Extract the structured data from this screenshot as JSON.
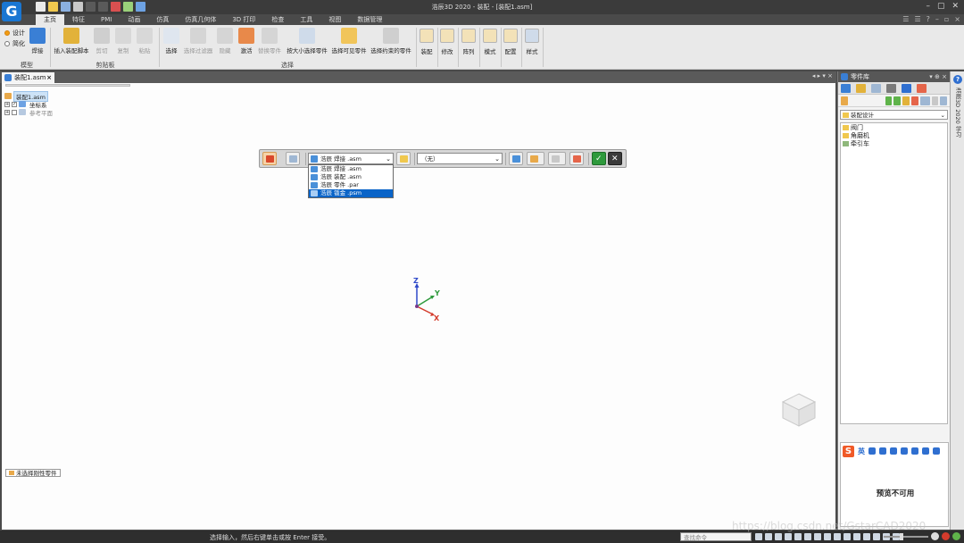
{
  "titlebar": {
    "title": "浩辰3D 2020 - 装配 - [装配1.asm]",
    "logo": "G"
  },
  "tabs": [
    {
      "label": "主页",
      "active": true
    },
    {
      "label": "特征",
      "active": false
    },
    {
      "label": "PMI",
      "active": false
    },
    {
      "label": "动画",
      "active": false
    },
    {
      "label": "仿真",
      "active": false
    },
    {
      "label": "仿真几何体",
      "active": false
    },
    {
      "label": "3D 打印",
      "active": false
    },
    {
      "label": "检查",
      "active": false
    },
    {
      "label": "工具",
      "active": false
    },
    {
      "label": "视图",
      "active": false
    },
    {
      "label": "数据管理",
      "active": false
    }
  ],
  "ribbon": {
    "mode_design": "设计",
    "mode_simplify": "简化",
    "weld": "焊接",
    "group_model": "模型",
    "insert_assembly_script": "插入装配脚本",
    "cut": "剪切",
    "copy": "复制",
    "paste": "粘贴",
    "group_clipboard": "剪贴板",
    "select": "选择",
    "select_filter": "选择过滤器",
    "hide": "隐藏",
    "activate": "激活",
    "replace_part": "替换零件",
    "select_by_size": "按大小选择零件",
    "select_visible": "选择可见零件",
    "select_constrained": "选择约束的零件",
    "group_select": "选择",
    "assemble": "装配",
    "modify": "修改",
    "array": "阵列",
    "pattern": "模式",
    "config": "配置",
    "style": "样式"
  },
  "document": {
    "tab_label": "装配1.asm",
    "tree": [
      {
        "label": "装配1.asm",
        "selected": true,
        "muted": false
      },
      {
        "label": "坐标系",
        "selected": false,
        "muted": false
      },
      {
        "label": "参考平面",
        "selected": false,
        "muted": true
      }
    ]
  },
  "command_bar": {
    "template_value": "浩辰 焊接 .asm",
    "second_value": "（无）",
    "template_options": [
      "浩辰 焊接 .asm",
      "浩辰 装配 .asm",
      "浩辰 零件 .par",
      "浩辰 钣金 .psm"
    ],
    "selected_index": 3
  },
  "axes": {
    "z": "Z",
    "y": "Y",
    "x": "X"
  },
  "canvas": {
    "status_chip": "未选择刚性零件"
  },
  "right_panel": {
    "title": "零件库",
    "combo_value": "装配设计",
    "items": [
      {
        "label": "阀门",
        "color": "yellow"
      },
      {
        "label": "角磨机",
        "color": "yellow"
      },
      {
        "label": "牵引车",
        "color": "green"
      }
    ],
    "ime_label": "英",
    "preview_unavailable": "预览不可用"
  },
  "vertical_strip": {
    "text": "浩辰3D 2020 学习"
  },
  "statusbar": {
    "message": "选择输入，然后右键单击或按 Enter 接受。",
    "search_placeholder": "查找命令"
  },
  "watermark": "https://blog.csdn.net/GstarCAD2020",
  "colors": {
    "accent": "#1976d2",
    "ribbon_bg": "#e9e9e9",
    "titlebar_bg": "#3b3b3b",
    "selected": "#0a64c8"
  }
}
